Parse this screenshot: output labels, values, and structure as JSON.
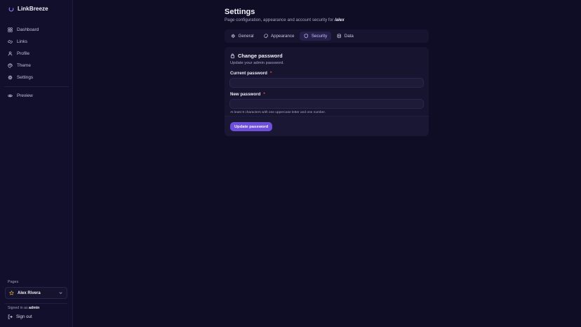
{
  "app": {
    "name": "LinkBreeze",
    "accent": "#6d4fdc"
  },
  "sidebar": {
    "items": [
      {
        "label": "Dashboard",
        "icon": "dashboard-icon"
      },
      {
        "label": "Links",
        "icon": "link-icon"
      },
      {
        "label": "Profile",
        "icon": "user-icon"
      },
      {
        "label": "Theme",
        "icon": "palette-icon"
      },
      {
        "label": "Settings",
        "icon": "gear-icon"
      }
    ],
    "preview": {
      "label": "Preview",
      "icon": "eye-icon"
    },
    "pages_label": "Pages",
    "selected_page": "Alex Rivera",
    "signed_in_prefix": "Signed in as",
    "signed_in_user": "admin",
    "sign_out": "Sign out"
  },
  "header": {
    "title": "Settings",
    "subtitle": "Page configuration, appearance and account security for",
    "handle": "/alex"
  },
  "tabs": [
    {
      "label": "General",
      "icon": "gear-icon",
      "active": false
    },
    {
      "label": "Appearance",
      "icon": "palette-icon",
      "active": false
    },
    {
      "label": "Security",
      "icon": "shield-icon",
      "active": true
    },
    {
      "label": "Data",
      "icon": "database-icon",
      "active": false
    }
  ],
  "card": {
    "title": "Change password",
    "subtitle": "Update your admin password.",
    "current_label": "Current password",
    "current_value": "",
    "new_label": "New password",
    "new_value": "",
    "required_mark": "*",
    "hint": "At least 8 characters with one uppercase letter and one number.",
    "submit": "Update password"
  }
}
